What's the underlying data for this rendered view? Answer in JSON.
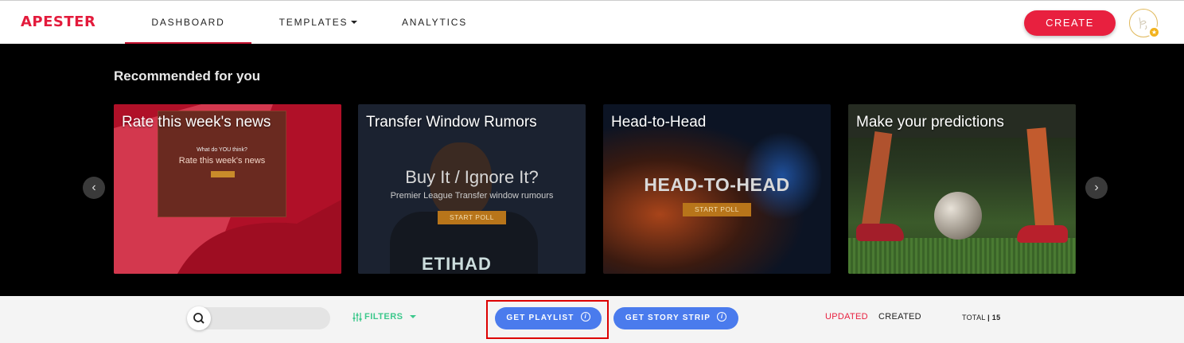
{
  "app": {
    "logo_text": "APESTER",
    "brand_color": "#e31b3c"
  },
  "nav": {
    "items": [
      {
        "label": "DASHBOARD",
        "active": true
      },
      {
        "label": "TEMPLATES",
        "has_dropdown": true
      },
      {
        "label": "ANALYTICS"
      }
    ],
    "create_label": "CREATE",
    "avatar_badge_icon": "star-icon"
  },
  "hero": {
    "title": "Recommended for you",
    "cards": [
      {
        "title": "Rate this week's news",
        "preview_question": "What do YOU think?",
        "preview_title": "Rate this week's news"
      },
      {
        "title": "Transfer Window Rumors",
        "preview_title": "Buy It / Ignore It?",
        "preview_subtitle": "Premier League Transfer window rumours",
        "preview_button": "START POLL",
        "preview_shirt_text": "ETIHAD"
      },
      {
        "title": "Head-to-Head",
        "preview_title": "HEAD-TO-HEAD",
        "preview_button": "START POLL"
      },
      {
        "title": "Make your predictions"
      }
    ],
    "prev_icon": "‹",
    "next_icon": "›"
  },
  "toolbar": {
    "search_placeholder": "",
    "filters_label": "FILTERS",
    "get_playlist_label": "GET PLAYLIST",
    "get_story_strip_label": "GET STORY STRIP",
    "info_icon": "i",
    "sort_updated": "UPDATED",
    "sort_created": "CREATED",
    "total_label": "TOTAL",
    "total_count": "15"
  },
  "colors": {
    "accent_red": "#e8203f",
    "button_blue": "#4a7bed",
    "filters_green": "#3cc88c"
  }
}
